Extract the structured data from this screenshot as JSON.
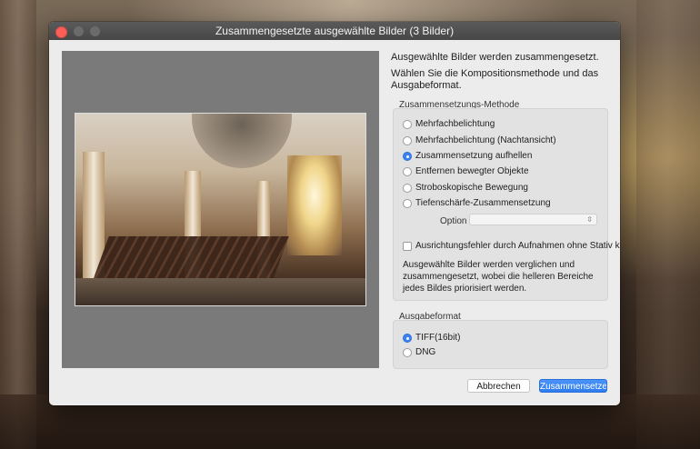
{
  "window": {
    "title": "Zusammengesetzte ausgewählte Bilder (3 Bilder)"
  },
  "intro": {
    "line1": "Ausgewählte Bilder werden zusammengesetzt.",
    "line2": "Wählen Sie die Kompositionsmethode und das Ausgabeformat."
  },
  "methods": {
    "label": "Zusammensetzungs-Methode",
    "options": [
      {
        "label": "Mehrfachbelichtung",
        "selected": false
      },
      {
        "label": "Mehrfachbelichtung (Nachtansicht)",
        "selected": false
      },
      {
        "label": "Zusammensetzung aufhellen",
        "selected": true
      },
      {
        "label": "Entfernen bewegter Objekte",
        "selected": false
      },
      {
        "label": "Stroboskopische Bewegung",
        "selected": false
      },
      {
        "label": "Tiefenschärfe-Zusammensetzung",
        "selected": false
      }
    ],
    "option_label": "Option",
    "option_value": "",
    "align_checkbox_label": "Ausrichtungsfehler durch Aufnahmen ohne Stativ korr",
    "align_checked": false,
    "description": "Ausgewählte Bilder werden verglichen und zusammengesetzt, wobei die helleren Bereiche jedes Bildes priorisiert werden."
  },
  "output": {
    "label": "Ausgabeformat",
    "formats": [
      {
        "label": "TIFF(16bit)",
        "selected": true
      },
      {
        "label": "DNG",
        "selected": false
      }
    ]
  },
  "buttons": {
    "cancel": "Abbrechen",
    "ok": "Zusammensetze"
  },
  "colors": {
    "accent": "#3b82f6",
    "close": "#fc5f57"
  }
}
